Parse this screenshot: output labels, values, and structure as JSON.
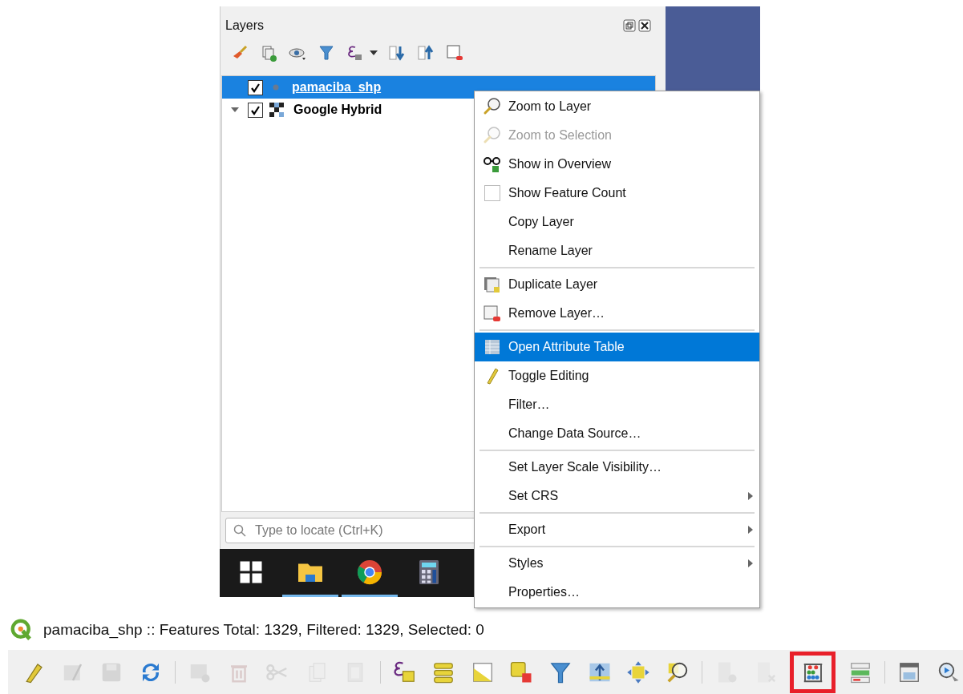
{
  "layers_panel": {
    "title": "Layers",
    "layers": [
      {
        "name": "pamaciba_shp",
        "kind": "vector",
        "checked": true,
        "selected": true
      },
      {
        "name": "Google Hybrid",
        "kind": "raster",
        "checked": true,
        "selected": false,
        "expanded": true
      }
    ],
    "search": {
      "placeholder": "Type to locate (Ctrl+K)"
    }
  },
  "taskbar": {
    "apps": [
      {
        "running": false
      },
      {
        "running": true
      },
      {
        "running": true
      },
      {
        "running": false
      }
    ]
  },
  "context_menu": {
    "groups": [
      [
        {
          "label": "Zoom to Layer",
          "kind": "icon",
          "disabled": false,
          "selected": false
        },
        {
          "label": "Zoom to Selection",
          "kind": "icon",
          "disabled": true,
          "selected": false
        },
        {
          "label": "Show in Overview",
          "kind": "icon",
          "disabled": false,
          "selected": false
        },
        {
          "label": "Show Feature Count",
          "kind": "checkbox",
          "checked": false,
          "disabled": false,
          "selected": false
        },
        {
          "label": "Copy Layer",
          "kind": "plain",
          "disabled": false,
          "selected": false
        },
        {
          "label": "Rename Layer",
          "kind": "plain",
          "disabled": false,
          "selected": false
        }
      ],
      [
        {
          "label": "Duplicate Layer",
          "kind": "icon",
          "disabled": false,
          "selected": false
        },
        {
          "label": "Remove Layer…",
          "kind": "icon",
          "disabled": false,
          "selected": false
        }
      ],
      [
        {
          "label": "Open Attribute Table",
          "kind": "icon",
          "disabled": false,
          "selected": true
        },
        {
          "label": "Toggle Editing",
          "kind": "icon",
          "disabled": false,
          "selected": false
        },
        {
          "label": "Filter…",
          "kind": "plain",
          "disabled": false,
          "selected": false
        },
        {
          "label": "Change Data Source…",
          "kind": "plain",
          "disabled": false,
          "selected": false
        }
      ],
      [
        {
          "label": "Set Layer Scale Visibility…",
          "kind": "plain",
          "disabled": false,
          "selected": false
        },
        {
          "label": "Set CRS",
          "kind": "submenu",
          "disabled": false,
          "selected": false
        }
      ],
      [
        {
          "label": "Export",
          "kind": "submenu",
          "disabled": false,
          "selected": false
        }
      ],
      [
        {
          "label": "Styles",
          "kind": "submenu",
          "disabled": false,
          "selected": false
        },
        {
          "label": "Properties…",
          "kind": "plain",
          "disabled": false,
          "selected": false
        }
      ]
    ]
  },
  "status": {
    "text": "pamaciba_shp :: Features Total: 1329, Filtered: 1329, Selected: 0"
  },
  "attribute_toolbar": [
    {
      "kind": "button",
      "disabled": false,
      "highlighted": false
    },
    {
      "kind": "button",
      "disabled": true,
      "highlighted": false
    },
    {
      "kind": "button",
      "disabled": true,
      "highlighted": false
    },
    {
      "kind": "button",
      "disabled": false,
      "highlighted": false
    },
    {
      "kind": "separator"
    },
    {
      "kind": "button",
      "disabled": true,
      "highlighted": false
    },
    {
      "kind": "button",
      "disabled": true,
      "highlighted": false
    },
    {
      "kind": "button",
      "disabled": true,
      "highlighted": false
    },
    {
      "kind": "button",
      "disabled": true,
      "highlighted": false
    },
    {
      "kind": "button",
      "disabled": true,
      "highlighted": false
    },
    {
      "kind": "separator"
    },
    {
      "kind": "button",
      "disabled": false,
      "highlighted": false
    },
    {
      "kind": "button",
      "disabled": false,
      "highlighted": false
    },
    {
      "kind": "button",
      "disabled": false,
      "highlighted": false
    },
    {
      "kind": "button",
      "disabled": false,
      "highlighted": false
    },
    {
      "kind": "button",
      "disabled": false,
      "highlighted": false
    },
    {
      "kind": "button",
      "disabled": false,
      "highlighted": false
    },
    {
      "kind": "button",
      "disabled": false,
      "highlighted": false
    },
    {
      "kind": "button",
      "disabled": false,
      "highlighted": false
    },
    {
      "kind": "separator"
    },
    {
      "kind": "button",
      "disabled": true,
      "highlighted": false
    },
    {
      "kind": "button",
      "disabled": true,
      "highlighted": false
    },
    {
      "kind": "button",
      "disabled": false,
      "highlighted": true
    },
    {
      "kind": "button",
      "disabled": false,
      "highlighted": false
    },
    {
      "kind": "separator"
    },
    {
      "kind": "button",
      "disabled": false,
      "highlighted": false
    },
    {
      "kind": "button",
      "disabled": false,
      "highlighted": false
    }
  ]
}
